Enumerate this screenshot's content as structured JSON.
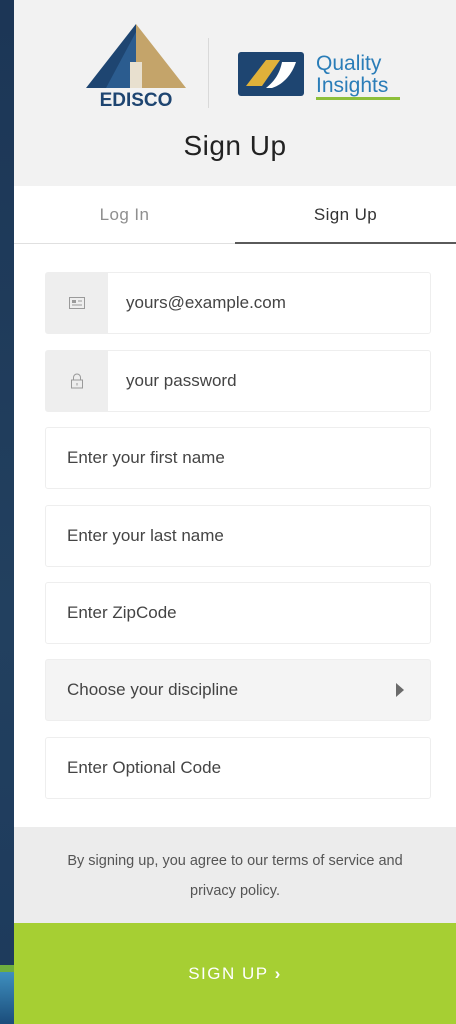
{
  "header": {
    "edisco_logo_text": "EDISCO",
    "qi_logo_line1": "Quality",
    "qi_logo_line2": "Insights",
    "title": "Sign Up"
  },
  "tabs": [
    {
      "label": "Log In",
      "active": false
    },
    {
      "label": "Sign Up",
      "active": true
    }
  ],
  "form": {
    "email": {
      "value": "yours@example.com",
      "icon": "envelope-icon"
    },
    "password": {
      "value": "your password",
      "icon": "lock-icon"
    },
    "first_name": {
      "placeholder": "Enter your first name"
    },
    "last_name": {
      "placeholder": "Enter your last name"
    },
    "zip": {
      "placeholder": "Enter ZipCode"
    },
    "discipline": {
      "placeholder": "Choose your discipline"
    },
    "optional_code": {
      "placeholder": "Enter Optional Code"
    }
  },
  "terms": {
    "line1": "By signing up, you agree to our terms of service and",
    "line2": "privacy policy."
  },
  "submit": {
    "label": "SIGN UP",
    "chevron": "›"
  },
  "colors": {
    "accent": "#a6cf33",
    "page_bg": "#1b2d47"
  }
}
